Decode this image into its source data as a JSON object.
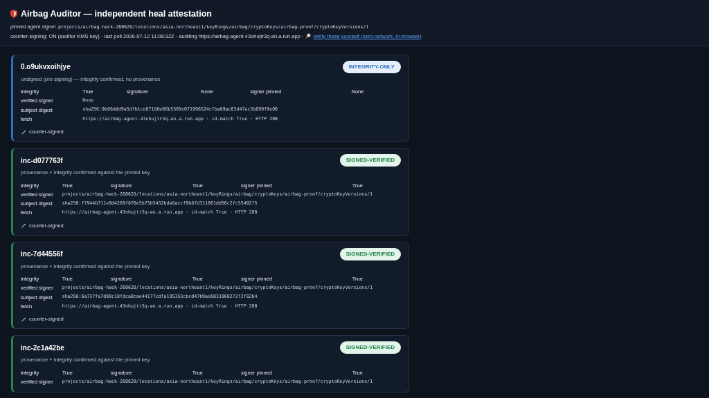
{
  "header": {
    "title": "Airbag Auditor — independent heal attestation",
    "signer_label": "pinned agent signer",
    "signer": "projects/airbag-hack-260628/locations/asia-northeast1/keyRings/airbag/cryptoKeys/airbag-proof/cryptoKeyVersions/1",
    "status_line": "counter-signing: ON (auditor KMS key) · last poll 2026-07-12 11:08:32Z · auditing https://airbag-agent-43ohujtr3q-an.a.run.app ·",
    "verify_link": "verify these yourself (zero-network, in-browser)"
  },
  "cards": [
    {
      "kind": "integrity-only",
      "id": "0.o9ukvxoihjye",
      "badge": "INTEGRITY-ONLY",
      "summary": "unsigned (pre-signing) — integrity confirmed, no provenance",
      "checks": [
        {
          "label": "integrity",
          "value": "True"
        },
        {
          "label": "signature",
          "value": "None"
        },
        {
          "label": "signer pinned",
          "value": "None"
        }
      ],
      "details": [
        {
          "label": "verified signer",
          "value": "None"
        },
        {
          "label": "subject digest",
          "value": "sha256:9b86ddd9a5dfb1ce07188e66b5569c071996524cfba69ac03d47ac3b099f9e00"
        },
        {
          "label": "fetch",
          "value": "https://airbag-agent-43ohujtr3q-an.a.run.app · id-match True · HTTP 200"
        }
      ],
      "footer": "counter-signed"
    },
    {
      "kind": "signed-verified",
      "id": "inc-d077763f",
      "badge": "SIGNED-VERIFIED",
      "summary": "provenance + integrity confirmed against the pinned key",
      "checks": [
        {
          "label": "integrity",
          "value": "True"
        },
        {
          "label": "signature",
          "value": "True"
        },
        {
          "label": "signer pinned",
          "value": "True"
        }
      ],
      "details": [
        {
          "label": "verified signer",
          "value": "projects/airbag-hack-260628/locations/asia-northeast1/keyRings/airbag/cryptoKeys/airbag-proof/cryptoKeyVersions/1"
        },
        {
          "label": "subject digest",
          "value": "sha256:f7944b711e0d4269f870e5b75b5432bda8accf0b87d311861dd56c2fc55492f5"
        },
        {
          "label": "fetch",
          "value": "https://airbag-agent-43ohujtr3q-an.a.run.app · id-match True · HTTP 200"
        }
      ],
      "footer": "counter-signed"
    },
    {
      "kind": "signed-verified",
      "id": "inc-7d44556f",
      "badge": "SIGNED-VERIFIED",
      "summary": "provenance + integrity confirmed against the pinned key",
      "checks": [
        {
          "label": "integrity",
          "value": "True"
        },
        {
          "label": "signature",
          "value": "True"
        },
        {
          "label": "signer pinned",
          "value": "True"
        }
      ],
      "details": [
        {
          "label": "verified signer",
          "value": "projects/airbag-hack-260628/locations/asia-northeast1/keyRings/airbag/cryptoKeys/airbag-proof/cryptoKeyVersions/1"
        },
        {
          "label": "subject digest",
          "value": "sha256:6a737fa7d98c18fdca0cae44177cdfa195353cbcd47b9ae6031960272f2f02b4"
        },
        {
          "label": "fetch",
          "value": "https://airbag-agent-43ohujtr3q-an.a.run.app · id-match True · HTTP 200"
        }
      ],
      "footer": "counter-signed"
    },
    {
      "kind": "signed-verified",
      "id": "inc-2c1a42be",
      "badge": "SIGNED-VERIFIED",
      "summary": "provenance + integrity confirmed against the pinned key",
      "checks": [
        {
          "label": "integrity",
          "value": "True"
        },
        {
          "label": "signature",
          "value": "True"
        },
        {
          "label": "signer pinned",
          "value": "True"
        }
      ],
      "details": [
        {
          "label": "verified signer",
          "value": "projects/airbag-hack-260628/locations/asia-northeast1/keyRings/airbag/cryptoKeys/airbag-proof/cryptoKeyVersions/1"
        }
      ]
    }
  ]
}
